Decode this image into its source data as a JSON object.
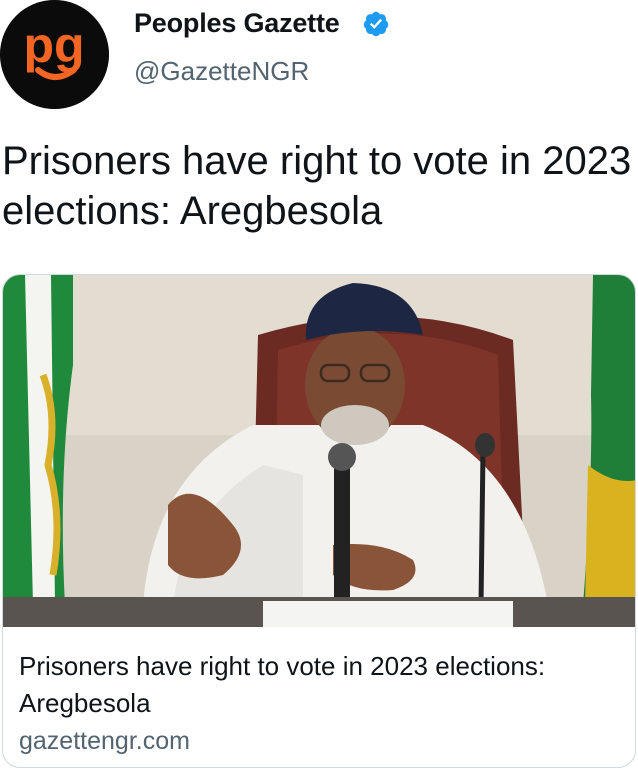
{
  "account": {
    "display_name": "Peoples Gazette",
    "handle": "@GazetteNGR",
    "verified": true,
    "avatar_icon": "pg-logo-icon",
    "avatar_text": "pg",
    "avatar_bg": "#0b0b0b",
    "avatar_accent": "#f26522"
  },
  "tweet": {
    "text": "Prisoners have right to vote in 2023 elections: Aregbesola"
  },
  "link_card": {
    "image_icon": "news-photo-speaker-at-microphone",
    "title": "Prisoners have right to vote in 2023 elections: Aregbesola",
    "domain": "gazettengr.com"
  },
  "colors": {
    "verified_blue": "#1d9bf0",
    "secondary_text": "#536471",
    "card_border": "#cfd9de"
  }
}
